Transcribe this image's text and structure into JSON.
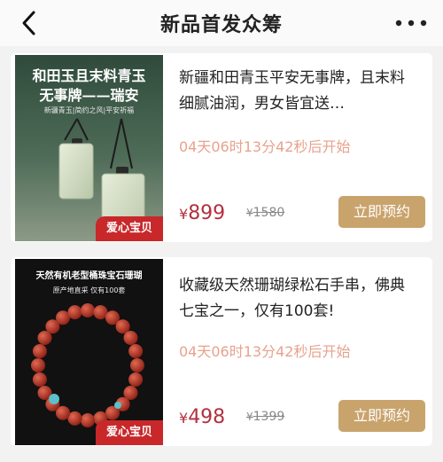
{
  "nav": {
    "title": "新品首发众筹"
  },
  "products": [
    {
      "image": {
        "heading_line1": "和田玉且末料青玉",
        "heading_line2": "无事牌——瑞安",
        "tagline": "新疆青玉|简约之风|平安祈福",
        "badge": "爱心宝贝"
      },
      "title": "新疆和田青玉平安无事牌，且末料细腻油润，男女皆宜送…",
      "countdown": "04天06时13分42秒后开始",
      "currency": "¥",
      "price": "899",
      "original_price": "1580",
      "reserve_label": "立即预约"
    },
    {
      "image": {
        "heading_line1": "天然有机老型桶珠宝石珊瑚",
        "tagline": "原产地直采    仅有100套",
        "badge": "爱心宝贝"
      },
      "title": "收藏级天然珊瑚绿松石手串，佛典七宝之一，仅有100套!",
      "countdown": "04天06时13分42秒后开始",
      "currency": "¥",
      "price": "498",
      "original_price": "1399",
      "reserve_label": "立即预约"
    }
  ],
  "colors": {
    "price": "#b4303e",
    "countdown": "#e8a28d",
    "reserve_button": "#c9a36c",
    "badge": "#c8282a"
  },
  "icons": {
    "back": "chevron-left-icon",
    "more": "more-dots-icon"
  }
}
